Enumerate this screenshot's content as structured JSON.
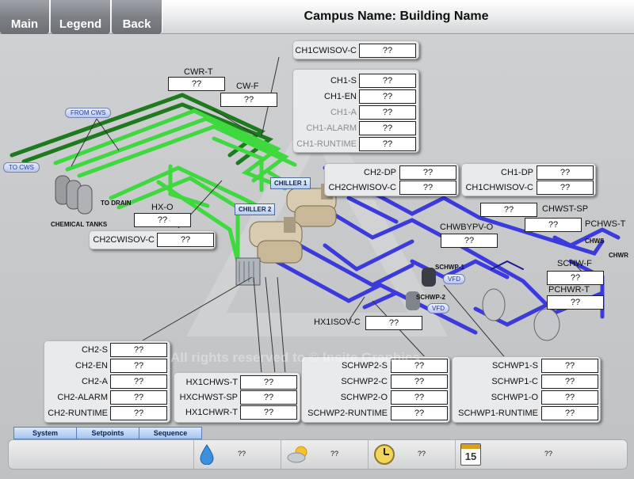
{
  "nav": {
    "main": "Main",
    "legend": "Legend",
    "back": "Back"
  },
  "title": "Campus Name: Building Name",
  "ph": "??",
  "ch1_cwisov": {
    "label": "CH1CWISOV-C"
  },
  "ch1": {
    "s": "CH1-S",
    "en": "CH1-EN",
    "a": "CH1-A",
    "alarm": "CH1-ALARM",
    "runtime": "CH1-RUNTIME"
  },
  "cwr_t": "CWR-T",
  "cw_f": "CW-F",
  "hx_o": "HX-O",
  "ch2_cwisov": "CH2CWISOV-C",
  "ch2_dp": "CH2-DP",
  "ch2_chwisov": "CH2CHWISOV-C",
  "ch1_dp": "CH1-DP",
  "ch1_chwisov": "CH1CHWISOV-C",
  "chwst_sp": "CHWST-SP",
  "pchws_t": "PCHWS-T",
  "chwbypv_o": "CHWBYPV-O",
  "schw_f": "SCHW-F",
  "pchwr_t": "PCHWR-T",
  "hx1isov_c": "HX1ISOV-C",
  "ch2": {
    "s": "CH2-S",
    "en": "CH2-EN",
    "a": "CH2-A",
    "alarm": "CH2-ALARM",
    "runtime": "CH2-RUNTIME"
  },
  "hx": {
    "hx1chws_t": "HX1CHWS-T",
    "hxchwst_sp": "HXCHWST-SP",
    "hx1chwr_t": "HX1CHWR-T"
  },
  "schwp2": {
    "s": "SCHWP2-S",
    "c": "SCHWP2-C",
    "o": "SCHWP2-O",
    "runtime": "SCHWP2-RUNTIME"
  },
  "schwp1": {
    "s": "SCHWP1-S",
    "c": "SCHWP1-C",
    "o": "SCHWP1-O",
    "runtime": "SCHWP1-RUNTIME"
  },
  "diagram": {
    "from_cws": "FROM CWS",
    "to_cws": "TO CWS",
    "to_drain": "TO DRAIN",
    "chemical_tanks": "CHEMICAL TANKS",
    "chiller1": "CHILLER 1",
    "chiller2": "CHILLER 2",
    "schwp1": "SCHWP-1",
    "schwp2": "SCHWP-2",
    "vfd": "VFD",
    "chws": "CHWS",
    "chwr": "CHWR"
  },
  "watermark": "All rights reserved to © Insite Graphics",
  "tabs": {
    "system": "System",
    "setpoints": "Setpoints",
    "sequence": "Sequence"
  },
  "status": {
    "humidity": "??",
    "weather": "??",
    "time": "??",
    "date": "??",
    "calendar_day": "15"
  },
  "colors": {
    "condenser_pipe": "#3fd83f",
    "condenser_pipe_dark": "#1d7a1d",
    "chilled_pipe": "#3b3bdc",
    "chilled_pipe_dark": "#1c1c8a"
  }
}
